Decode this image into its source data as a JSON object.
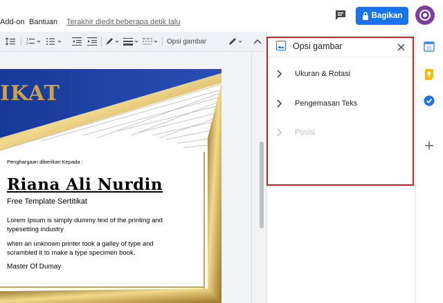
{
  "menu": {
    "items": [
      "Add-on",
      "Bantuan"
    ],
    "last_edit": "Terakhir diedit beberapa detik lalu",
    "share_label": "Bagikan"
  },
  "toolbar": {
    "image_options_label": "Opsi gambar"
  },
  "certificate": {
    "heading": "IKAT",
    "awarded_to": "Penghargaan diberikan Kepada :",
    "name": "Riana Ali Nurdin",
    "subtitle": "Free Template Sertitikat",
    "para1": "Lorem Ipsum is simply dummy text of the printing and typesetting industry",
    "para2": "when an unknown printer took a galley of type and scrambled it to make a type specimen book.",
    "signature": "Master Of Dumay"
  },
  "panel": {
    "title": "Opsi gambar",
    "items": [
      {
        "label": "Ukuran & Rotasi",
        "enabled": true
      },
      {
        "label": "Pengemasan Teks",
        "enabled": true
      },
      {
        "label": "Posisi",
        "enabled": false
      }
    ]
  },
  "colors": {
    "accent": "#1a73e8",
    "highlight": "#e01b22",
    "cert_blue": "#1f3f9e",
    "cert_gold": "#c9a24a"
  }
}
